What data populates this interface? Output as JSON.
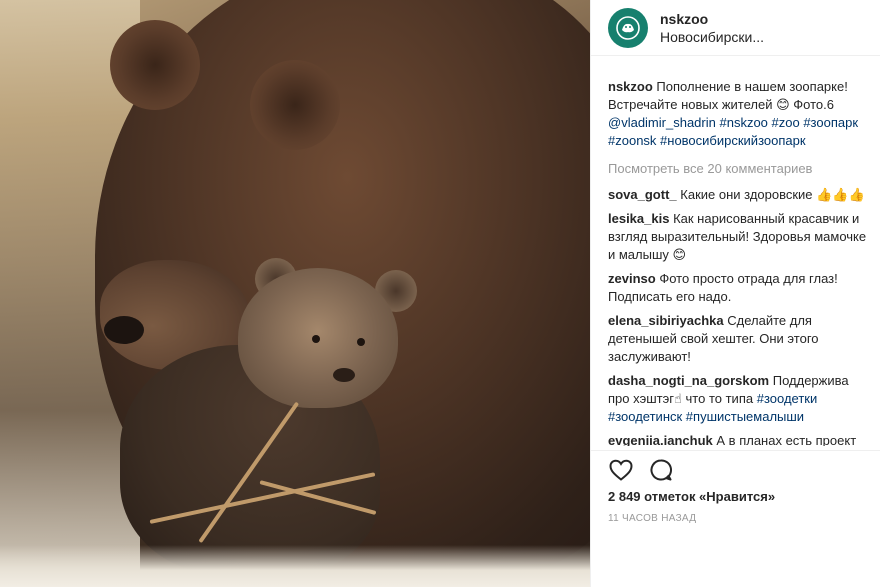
{
  "post": {
    "username": "nskzoo",
    "location": "Новосибирски...",
    "caption": {
      "user": "nskzoo",
      "text": "Пополнение в нашем зоопарке! Встречайте новых жителей 😊 Фото.6",
      "mention": "@vladimir_shadrin",
      "tags": "#nskzoo #zoo #зоопарк #zoonsk #новосибирскийзоопарк"
    },
    "view_all_comments": "Посмотреть все 20 комментариев",
    "comments": [
      {
        "user": "sova_gott_",
        "text": "Какие они здоровские 👍👍👍"
      },
      {
        "user": "lesika_kis",
        "text": "Как нарисованный красавчик и взгляд выразительный! Здоровья мамочке и малышу 😊"
      },
      {
        "user": "zevinso",
        "text": "Фото просто отрада для глаз! Подписать его надо."
      },
      {
        "user": "elena_sibiriyachka",
        "text": "Сделайте для детенышей свой хештег. Они этого заслуживают!"
      },
      {
        "user": "dasha_nogti_na_gorskom",
        "text": "Поддержива про хэштэг☝ что то типа",
        "tags": "#зоодетки #зоодетинск #пушистыемалыши"
      },
      {
        "user": "evgeniia.ianchuk",
        "text": "А в планах есть проект дома для бурых мишек такой как у Кая и"
      }
    ],
    "likes": "2 849 отметок «Нравится»",
    "time": "11 ЧАСОВ НАЗАД"
  },
  "colors": {
    "avatar_bg": "#17806e",
    "link": "#003569",
    "muted": "#999999"
  },
  "icons": {
    "like": "heart-icon",
    "comment": "comment-icon"
  }
}
